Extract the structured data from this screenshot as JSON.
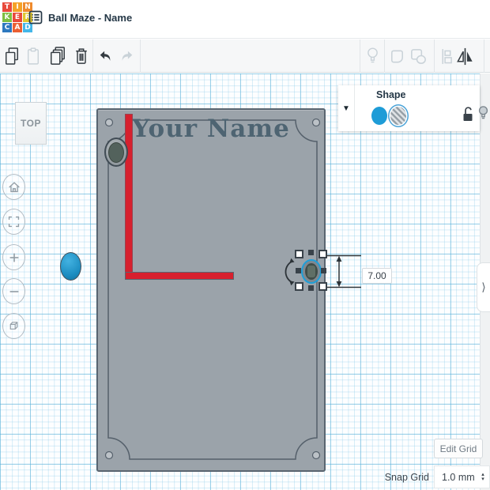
{
  "header": {
    "title": "Ball Maze - Name"
  },
  "logo": {
    "tiles": [
      {
        "letter": "T",
        "color": "#e8493b"
      },
      {
        "letter": "I",
        "color": "#f5a227"
      },
      {
        "letter": "N",
        "color": "#ef8a2c"
      },
      {
        "letter": "K",
        "color": "#7dbf42"
      },
      {
        "letter": "E",
        "color": "#e8493b"
      },
      {
        "letter": "R",
        "color": "#e0c62f"
      },
      {
        "letter": "C",
        "color": "#2e79bf"
      },
      {
        "letter": "A",
        "color": "#ea5f33"
      },
      {
        "letter": "D",
        "color": "#44b6e8"
      }
    ]
  },
  "view_cube": {
    "label": "TOP"
  },
  "shape_panel": {
    "title": "Shape",
    "dropdown_glyph": "▼"
  },
  "scene": {
    "name_plate_text": "Your Name",
    "dimension_value": "7.00"
  },
  "status_bar": {
    "edit_grid_label": "Edit Grid",
    "snap_grid_label": "Snap Grid",
    "snap_grid_value": "1.0 mm",
    "dropdown_up": "▴",
    "dropdown_down": "▾"
  },
  "side_panel": {
    "toggle_glyph": "⟩"
  },
  "colors": {
    "selection_blue": "#1e9fd8",
    "wall_red": "#d7202e",
    "board_gray": "#9ba3aa",
    "ball_blue": "#1e9cd7"
  }
}
